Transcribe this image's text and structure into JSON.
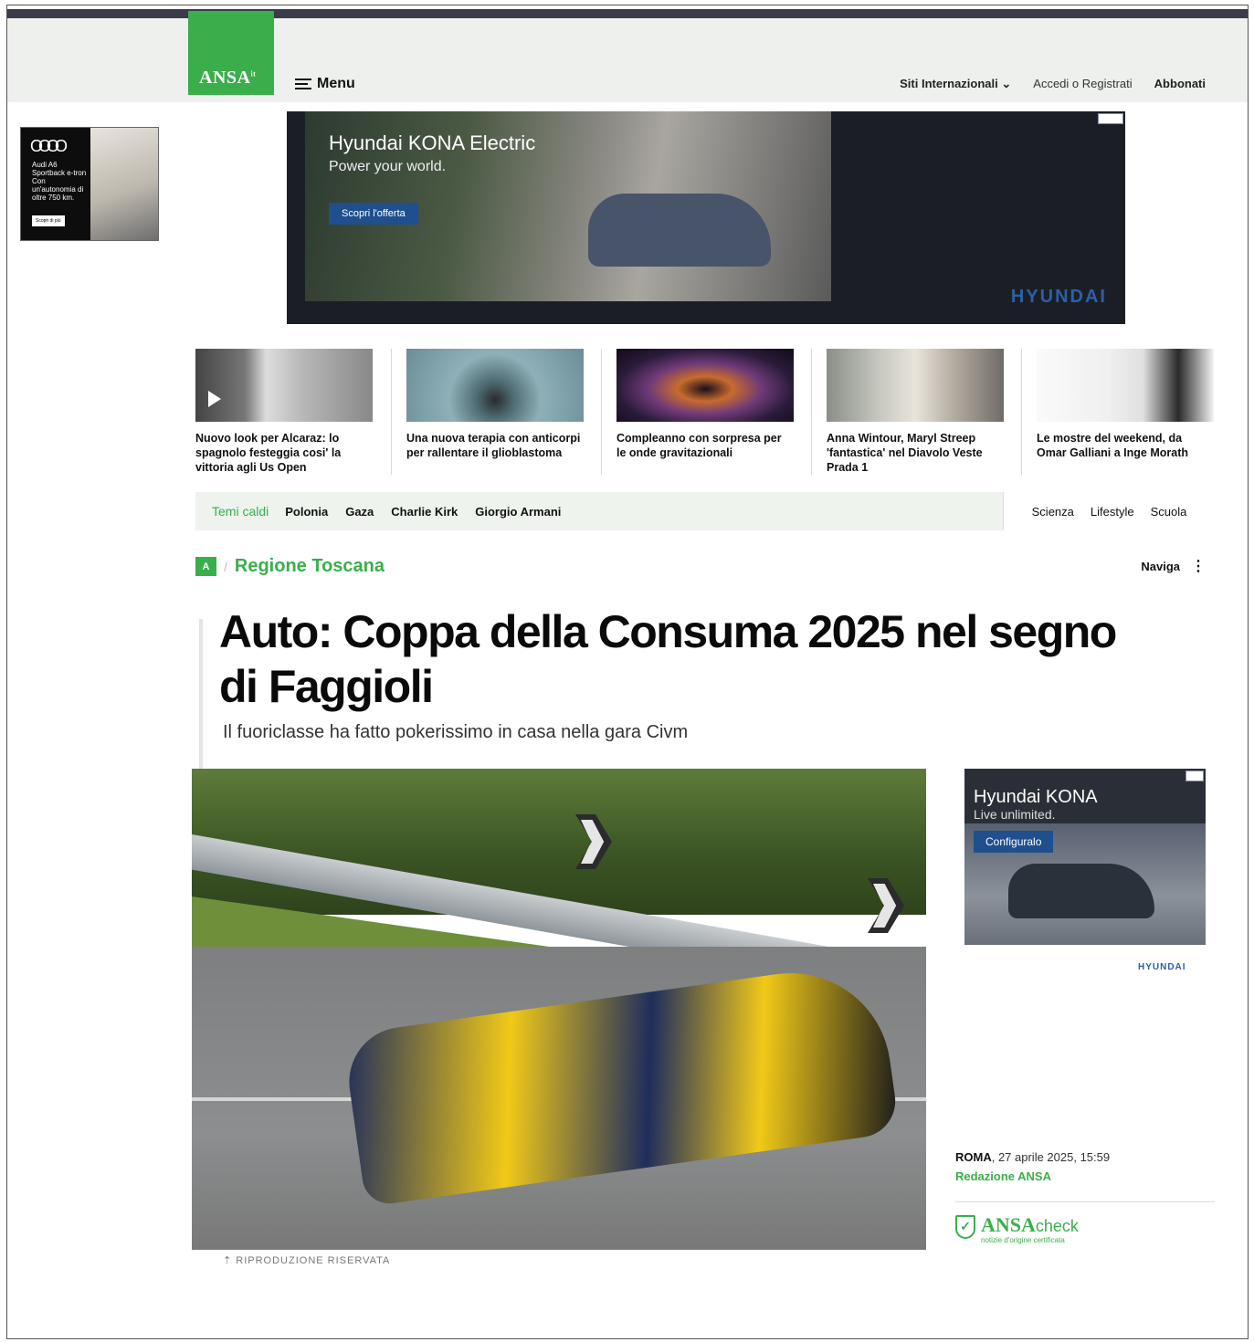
{
  "header": {
    "logo": "ANSA",
    "logo_suffix": "it",
    "menu_label": "Menu",
    "links": {
      "international": "Siti Internazionali",
      "login": "Accedi o Registrati",
      "subscribe": "Abbonati"
    }
  },
  "ads": {
    "side_left": {
      "brand_rings": "OOOO",
      "text": "Audi A6 Sportback e-tron Con un'autonomia di oltre 750 km.",
      "cta": "Scopri di più"
    },
    "top": {
      "title": "Hyundai KONA Electric",
      "subtitle": "Power your world.",
      "cta": "Scopri l'offerta",
      "brand": "HYUNDAI"
    },
    "right": {
      "title": "Hyundai KONA",
      "subtitle": "Live unlimited.",
      "cta": "Configuralo",
      "brand": "HYUNDAI"
    }
  },
  "stories": [
    {
      "title": "Nuovo look per Alcaraz: lo spagnolo festeggia cosi' la vittoria agli Us Open"
    },
    {
      "title": "Una nuova terapia con anticorpi per rallentare il glioblastoma"
    },
    {
      "title": "Compleanno con sorpresa per le onde gravitazionali"
    },
    {
      "title": "Anna Wintour, Maryl Streep 'fantastica' nel Diavolo Veste Prada 1"
    },
    {
      "title": "Le mostre del weekend, da Omar Galliani a Inge Morath"
    }
  ],
  "topics": {
    "label": "Temi caldi",
    "items": [
      "Polonia",
      "Gaza",
      "Charlie Kirk",
      "Giorgio Armani"
    ],
    "sections": [
      "Scienza",
      "Lifestyle",
      "Scuola"
    ]
  },
  "article": {
    "section_badge": "A",
    "region": "Regione Toscana",
    "naviga": "Naviga",
    "headline": "Auto: Coppa della Consuma 2025 nel segno di Faggioli",
    "subhead": "Il fuoriclasse ha fatto pokerissimo in casa nella gara Civm",
    "caption": "RIPRODUZIONE RISERVATA",
    "city": "ROMA",
    "date": ", 27 aprile 2025, 15:59",
    "author": "Redazione ANSA",
    "check_brand": "ANSA",
    "check_word": "check",
    "check_tagline": "notizie d'origine certificata"
  },
  "colors": {
    "accent_green": "#3aae4b",
    "hyundai_blue": "#2c5fa8",
    "stripe": "#3a3a4a"
  }
}
